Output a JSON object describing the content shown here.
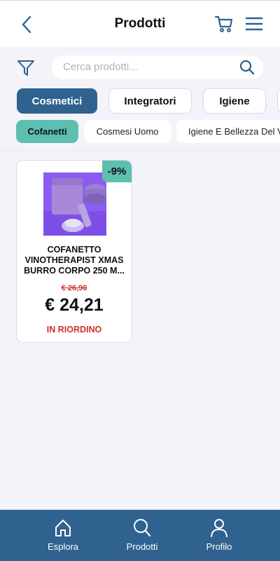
{
  "header": {
    "title": "Prodotti",
    "icons": [
      "chevron-left-icon",
      "cart-icon",
      "menu-icon"
    ]
  },
  "search": {
    "placeholder": "Cerca prodotti...",
    "icons": [
      "filter-icon",
      "search-icon"
    ]
  },
  "categories": [
    {
      "label": "Cosmetici",
      "active": true
    },
    {
      "label": "Integratori",
      "active": false
    },
    {
      "label": "Igiene",
      "active": false
    }
  ],
  "subcategories": [
    {
      "label": "Cofanetti",
      "active": true
    },
    {
      "label": "Cosmesi Uomo",
      "active": false
    },
    {
      "label": "Igiene E Bellezza Del V",
      "active": false
    }
  ],
  "product": {
    "discount": "-9%",
    "name": "COFANETTO VINOTHERAPIST XMAS BURRO CORPO 250 M...",
    "old_price": "€ 26,90",
    "price": "€ 24,21",
    "status": "IN RIORDINO"
  },
  "bottom_nav": [
    {
      "label": "Esplora",
      "icon": "home-icon"
    },
    {
      "label": "Prodotti",
      "icon": "search-icon"
    },
    {
      "label": "Profilo",
      "icon": "user-icon"
    }
  ],
  "colors": {
    "primary": "#2f628f",
    "accent": "#5ebfb0",
    "alert": "#d2302b",
    "background": "#f3f3f9"
  }
}
